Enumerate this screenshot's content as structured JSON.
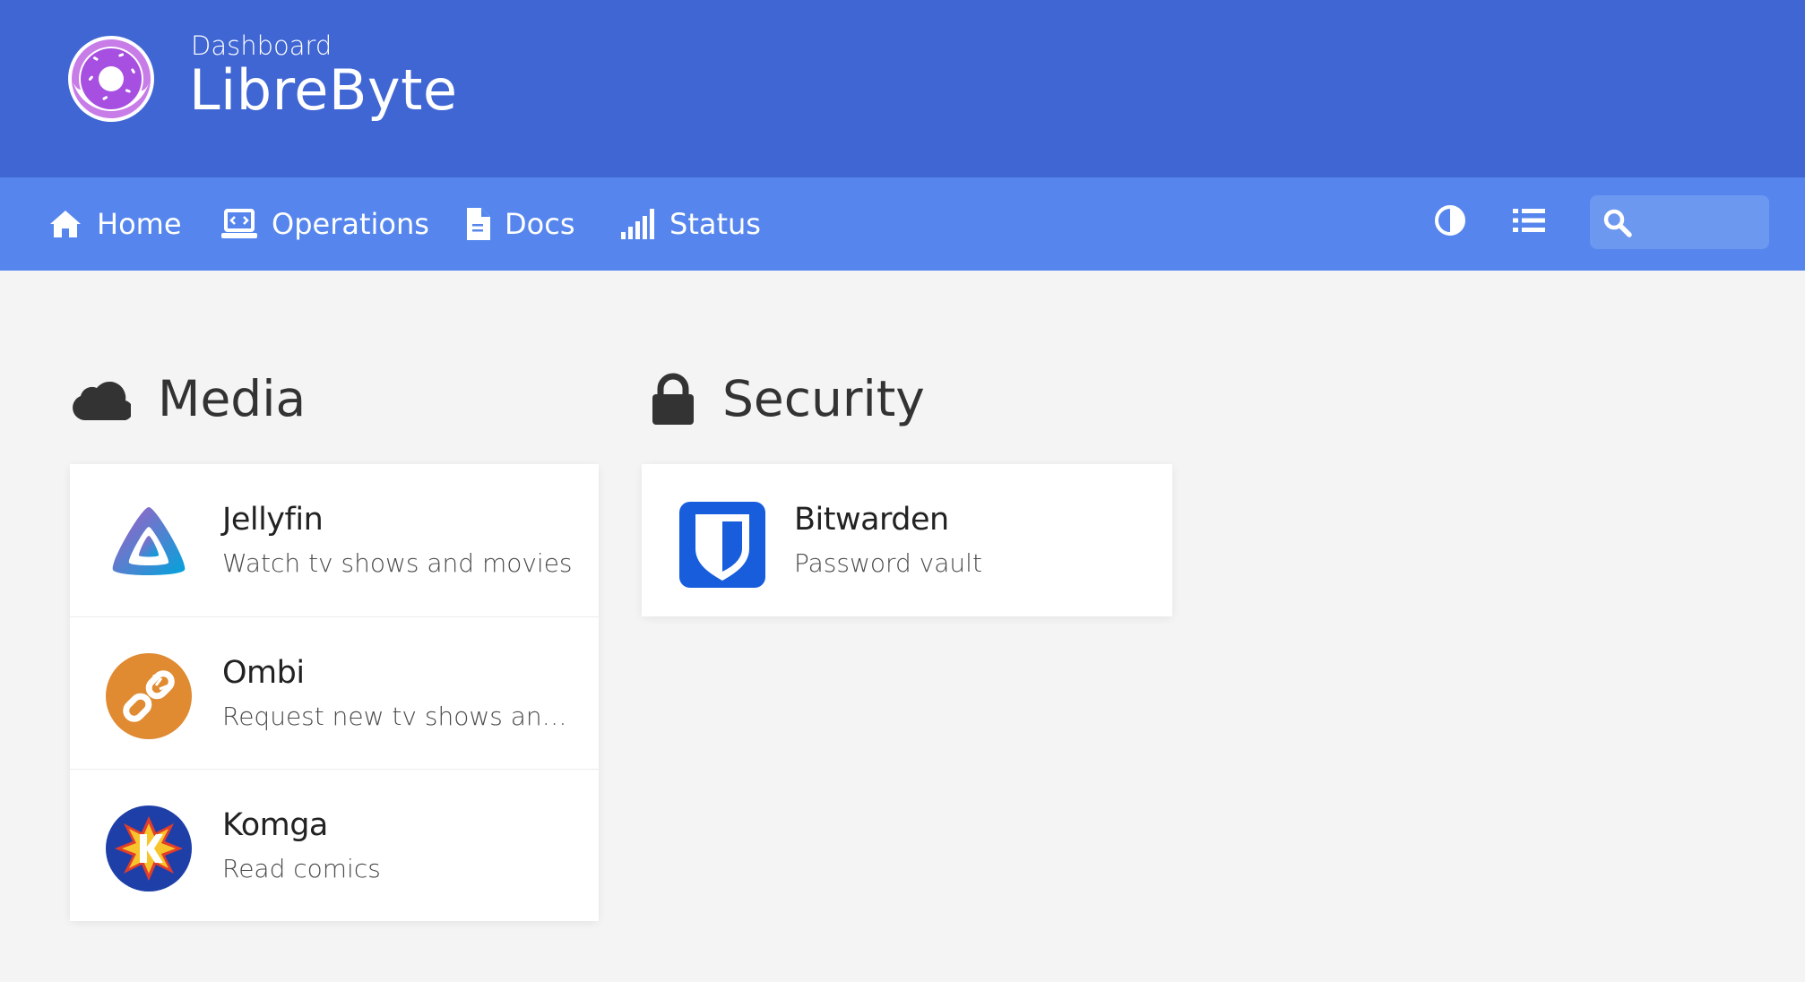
{
  "header": {
    "subtitle": "Dashboard",
    "title": "LibreByte",
    "logo_icon": "donut-logo-icon"
  },
  "nav": {
    "items": [
      {
        "label": "Home",
        "icon": "home-icon"
      },
      {
        "label": "Operations",
        "icon": "laptop-code-icon"
      },
      {
        "label": "Docs",
        "icon": "file-icon"
      },
      {
        "label": "Status",
        "icon": "signal-bars-icon"
      }
    ],
    "tools": [
      {
        "name": "theme-toggle",
        "icon": "contrast-icon"
      },
      {
        "name": "layout-toggle",
        "icon": "list-icon"
      }
    ],
    "search": {
      "value": "",
      "icon": "search-icon"
    }
  },
  "sections": [
    {
      "title": "Media",
      "icon": "cloud-icon",
      "services": [
        {
          "name": "Jellyfin",
          "subtitle": "Watch tv shows and movies",
          "icon": "jellyfin-icon"
        },
        {
          "name": "Ombi",
          "subtitle": "Request new tv shows and movies",
          "icon": "ombi-icon"
        },
        {
          "name": "Komga",
          "subtitle": "Read comics",
          "icon": "komga-icon"
        }
      ]
    },
    {
      "title": "Security",
      "icon": "lock-icon",
      "services": [
        {
          "name": "Bitwarden",
          "subtitle": "Password vault",
          "icon": "bitwarden-icon"
        }
      ]
    }
  ],
  "colors": {
    "header_bg": "#4066d4",
    "navbar_bg": "#5686ed",
    "page_bg": "#f4f4f4",
    "card_bg": "#ffffff"
  }
}
